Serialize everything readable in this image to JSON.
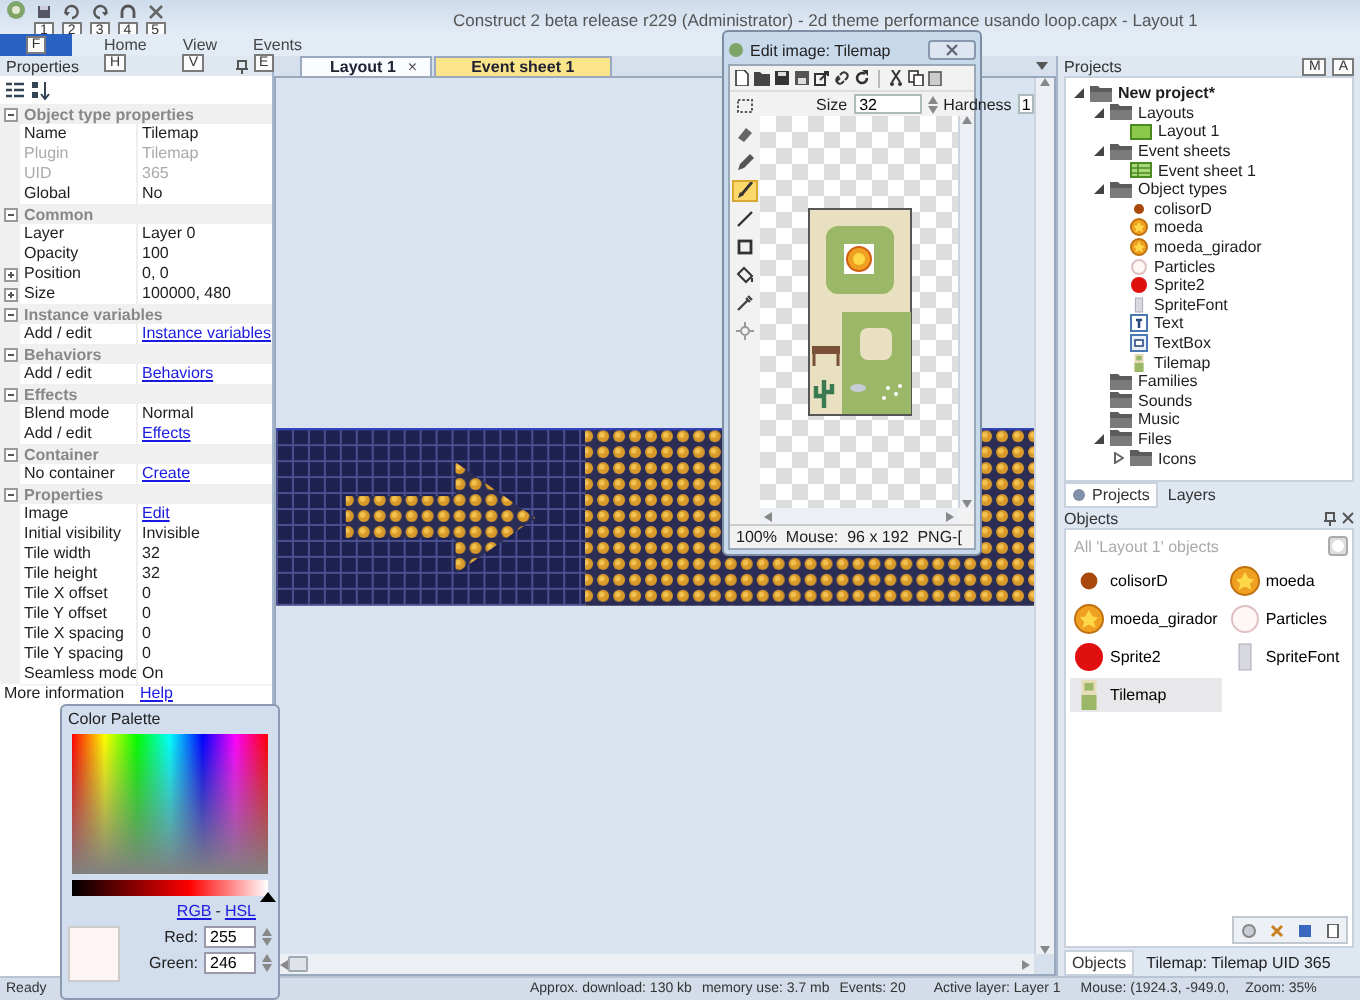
{
  "window": {
    "title": "Construct 2 beta release r229 (Administrator) - 2d theme performance usando loop.capx - Layout 1",
    "quick_access_keytips": [
      "1",
      "2",
      "3",
      "4",
      "5"
    ]
  },
  "ribbon": {
    "file_keytip": "F",
    "tabs": [
      {
        "label": "Home",
        "keytip": "H"
      },
      {
        "label": "View",
        "keytip": "V"
      },
      {
        "label": "Events",
        "keytip": "E"
      }
    ]
  },
  "properties": {
    "title": "Properties",
    "sections": [
      {
        "title": "Object type properties",
        "expanded": true,
        "rows": [
          {
            "name": "Name",
            "value": "Tilemap",
            "kind": "text"
          },
          {
            "name": "Plugin",
            "value": "Tilemap",
            "kind": "readonly"
          },
          {
            "name": "UID",
            "value": "365",
            "kind": "readonly"
          },
          {
            "name": "Global",
            "value": "No",
            "kind": "text"
          }
        ]
      },
      {
        "title": "Common",
        "expanded": true,
        "rows": [
          {
            "name": "Layer",
            "value": "Layer 0",
            "kind": "text"
          },
          {
            "name": "Opacity",
            "value": "100",
            "kind": "text"
          },
          {
            "name": "Position",
            "value": "0, 0",
            "kind": "text",
            "expanded": false
          },
          {
            "name": "Size",
            "value": "100000, 480",
            "kind": "text",
            "expanded": false
          }
        ]
      },
      {
        "title": "Instance variables",
        "expanded": true,
        "rows": [
          {
            "name": "Add / edit",
            "value": "Instance variables",
            "kind": "link"
          }
        ]
      },
      {
        "title": "Behaviors",
        "expanded": true,
        "rows": [
          {
            "name": "Add / edit",
            "value": "Behaviors",
            "kind": "link"
          }
        ]
      },
      {
        "title": "Effects",
        "expanded": true,
        "rows": [
          {
            "name": "Blend mode",
            "value": "Normal",
            "kind": "text"
          },
          {
            "name": "Add / edit",
            "value": "Effects",
            "kind": "link"
          }
        ]
      },
      {
        "title": "Container",
        "expanded": true,
        "rows": [
          {
            "name": "No container",
            "value": "Create",
            "kind": "link"
          }
        ]
      },
      {
        "title": "Properties",
        "expanded": true,
        "rows": [
          {
            "name": "Image",
            "value": "Edit",
            "kind": "link"
          },
          {
            "name": "Initial visibility",
            "value": "Invisible",
            "kind": "text"
          },
          {
            "name": "Tile width",
            "value": "32",
            "kind": "text"
          },
          {
            "name": "Tile height",
            "value": "32",
            "kind": "text"
          },
          {
            "name": "Tile X offset",
            "value": "0",
            "kind": "text"
          },
          {
            "name": "Tile Y offset",
            "value": "0",
            "kind": "text"
          },
          {
            "name": "Tile X spacing",
            "value": "0",
            "kind": "text"
          },
          {
            "name": "Tile Y spacing",
            "value": "0",
            "kind": "text"
          },
          {
            "name": "Seamless mode",
            "value": "On",
            "kind": "text"
          }
        ]
      }
    ],
    "footer": {
      "name": "More information",
      "value": "Help"
    }
  },
  "editor_tabs": [
    {
      "label": "Layout 1",
      "kind": "layout",
      "selected": true,
      "close": "×"
    },
    {
      "label": "Event sheet 1",
      "kind": "event-sheet",
      "selected": false
    }
  ],
  "image_editor": {
    "title": "Edit image: Tilemap",
    "tools": [
      {
        "kind": "select",
        "selected": false
      },
      {
        "kind": "eraser",
        "selected": false
      },
      {
        "kind": "pencil",
        "selected": false
      },
      {
        "kind": "brush",
        "selected": true
      },
      {
        "kind": "line",
        "selected": false
      },
      {
        "kind": "rectangle",
        "selected": false
      },
      {
        "kind": "fill",
        "selected": false
      },
      {
        "kind": "picker",
        "selected": false
      },
      {
        "kind": "hotspot",
        "selected": false
      }
    ],
    "size_label": "Size",
    "size": "32",
    "hardness_label": "Hardness",
    "hardness": "1",
    "status": "100%  Mouse:  96 x 192  PNG-["
  },
  "projects": {
    "title": "Projects",
    "keytips": [
      "M",
      "A"
    ],
    "tree": [
      {
        "label": "New project*",
        "kind": "project",
        "expanded": true,
        "children": [
          {
            "label": "Layouts",
            "kind": "folder",
            "expanded": true,
            "children": [
              {
                "label": "Layout 1",
                "kind": "layout"
              }
            ]
          },
          {
            "label": "Event sheets",
            "kind": "folder",
            "expanded": true,
            "children": [
              {
                "label": "Event sheet 1",
                "kind": "event-sheet"
              }
            ]
          },
          {
            "label": "Object types",
            "kind": "folder",
            "expanded": true,
            "children": [
              {
                "label": "colisorD",
                "kind": "dot",
                "color": "#a8480c"
              },
              {
                "label": "moeda",
                "kind": "coin"
              },
              {
                "label": "moeda_girador",
                "kind": "coin"
              },
              {
                "label": "Particles",
                "kind": "ring"
              },
              {
                "label": "Sprite2",
                "kind": "disc",
                "color": "#e01010"
              },
              {
                "label": "SpriteFont",
                "kind": "font-sheet"
              },
              {
                "label": "Text",
                "kind": "text"
              },
              {
                "label": "TextBox",
                "kind": "textbox"
              },
              {
                "label": "Tilemap",
                "kind": "tilemap"
              }
            ]
          },
          {
            "label": "Families",
            "kind": "folder"
          },
          {
            "label": "Sounds",
            "kind": "folder"
          },
          {
            "label": "Music",
            "kind": "folder"
          },
          {
            "label": "Files",
            "kind": "folder",
            "expanded": true,
            "children": [
              {
                "label": "Icons",
                "kind": "folder",
                "expanded": false
              }
            ]
          }
        ]
      }
    ],
    "tabs": [
      {
        "label": "Projects",
        "selected": true
      },
      {
        "label": "Layers",
        "selected": false
      }
    ]
  },
  "objects": {
    "title": "Objects",
    "filter_placeholder": "All 'Layout 1' objects",
    "items": [
      {
        "label": "colisorD",
        "kind": "dot",
        "color": "#a8480c",
        "selected": false
      },
      {
        "label": "moeda",
        "kind": "coin",
        "selected": false
      },
      {
        "label": "moeda_girador",
        "kind": "coin",
        "selected": false
      },
      {
        "label": "Particles",
        "kind": "ring",
        "selected": false
      },
      {
        "label": "Sprite2",
        "kind": "disc",
        "color": "#e01010",
        "selected": false
      },
      {
        "label": "SpriteFont",
        "kind": "font-sheet",
        "selected": false
      },
      {
        "label": "Tilemap",
        "kind": "tilemap",
        "selected": true
      }
    ],
    "tabs": [
      {
        "label": "Objects",
        "selected": true
      }
    ],
    "selection_info": "Tilemap: Tilemap UID 365"
  },
  "color_palette": {
    "title": "Color Palette",
    "brightness": {
      "level": 1
    },
    "links": [
      "RGB",
      "HSL"
    ],
    "link_separator": "-",
    "fields": [
      {
        "label": "Red:",
        "value": "255"
      },
      {
        "label": "Green:",
        "value": "246"
      }
    ]
  },
  "status_bar": {
    "ready": "Ready",
    "download": "Approx. download: 130 kb",
    "memory": "memory use: 3.7 mb",
    "events": "Events: 20",
    "active_layer": "Active layer: Layer 1",
    "mouse": "Mouse: (1924.3, -949.0,",
    "zoom": "Zoom: 35%"
  }
}
